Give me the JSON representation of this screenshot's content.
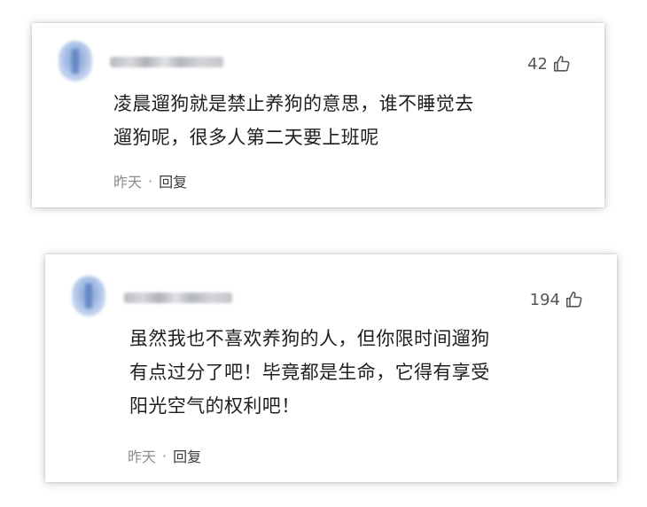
{
  "comments": [
    {
      "likes": "42",
      "lines": [
        "凌晨遛狗就是禁止养狗的意思，谁不睡觉去",
        "遛狗呢，很多人第二天要上班呢"
      ],
      "time": "昨天",
      "separator": "·",
      "reply_label": "回复",
      "like_icon": "thumbs-up-outline-icon"
    },
    {
      "likes": "194",
      "lines": [
        "虽然我也不喜欢养狗的人，但你限时间遛狗",
        "有点过分了吧！毕竟都是生命，它得有享受",
        "阳光空气的权利吧！"
      ],
      "time": "昨天",
      "separator": "·",
      "reply_label": "回复",
      "like_icon": "thumbs-up-outline-icon"
    }
  ],
  "colors": {
    "text": "#1f1f1f",
    "meta": "#8c8c8c",
    "likes": "#555555",
    "avatar": "#7f9ed3"
  }
}
